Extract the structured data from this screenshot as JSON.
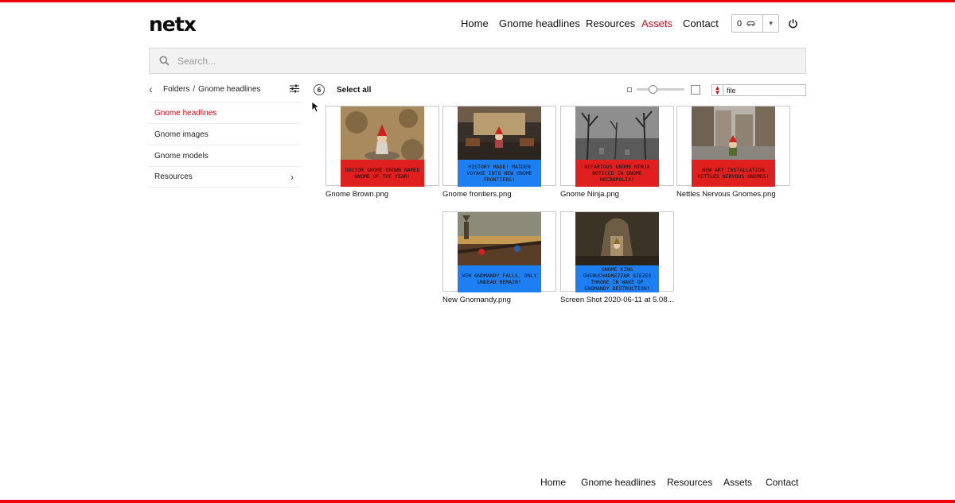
{
  "header": {
    "logo": "netx",
    "nav": [
      {
        "label": "Home",
        "active": false
      },
      {
        "label": "Gnome headlines",
        "active": false
      },
      {
        "label": "Resources",
        "active": false
      },
      {
        "label": "Assets",
        "active": true
      },
      {
        "label": "Contact",
        "active": false
      }
    ],
    "cart_count": "0",
    "cart_icon": "car-icon",
    "power_icon": "power-icon"
  },
  "search": {
    "placeholder": "Search...",
    "value": ""
  },
  "breadcrumb": {
    "root": "Folders",
    "separator": "/",
    "current": "Gnome headlines"
  },
  "sidebar": {
    "items": [
      {
        "label": "Gnome headlines",
        "active": true,
        "has_children": false
      },
      {
        "label": "Gnome images",
        "active": false,
        "has_children": false
      },
      {
        "label": "Gnome models",
        "active": false,
        "has_children": false
      },
      {
        "label": "Resources",
        "active": false,
        "has_children": true
      }
    ]
  },
  "toolbar": {
    "count": "6",
    "select_all": "Select all",
    "thumbnail_size_fraction": 0.3,
    "sort_value": "file"
  },
  "assets": [
    {
      "name": "Gnome Brown.png",
      "caption": "Doctor Gnome Brown named Gnome of the Year!",
      "caption_color": "red"
    },
    {
      "name": "Gnome frontiers.png",
      "caption": "History made! Maiden voyage into new gnome frontiers!",
      "caption_color": "blue"
    },
    {
      "name": "Gnome Ninja.png",
      "caption": "Nefarious gnome ninja noticed in gnome necropolis!",
      "caption_color": "red"
    },
    {
      "name": "Nettles Nervous Gnomes.png",
      "caption": "New art installation Nettles nervous gnomes!",
      "caption_color": "red"
    },
    {
      "name": "New Gnomandy.png",
      "caption": "New Gnomandy falls, only undead remain!",
      "caption_color": "blue"
    },
    {
      "name": "Screen Shot 2020-06-11 at 5.08....",
      "caption": "Gnome King Gnebuchadnezzar siezes throne in wake of Gnomandy destruction!",
      "caption_color": "blue"
    }
  ],
  "footer": {
    "nav": [
      "Home",
      "Gnome headlines",
      "Resources",
      "Assets",
      "Contact"
    ]
  },
  "colors": {
    "accent": "#e8000b",
    "active_text": "#cc1020",
    "caption_red": "#e01f1f",
    "caption_blue": "#1e7ff2"
  }
}
